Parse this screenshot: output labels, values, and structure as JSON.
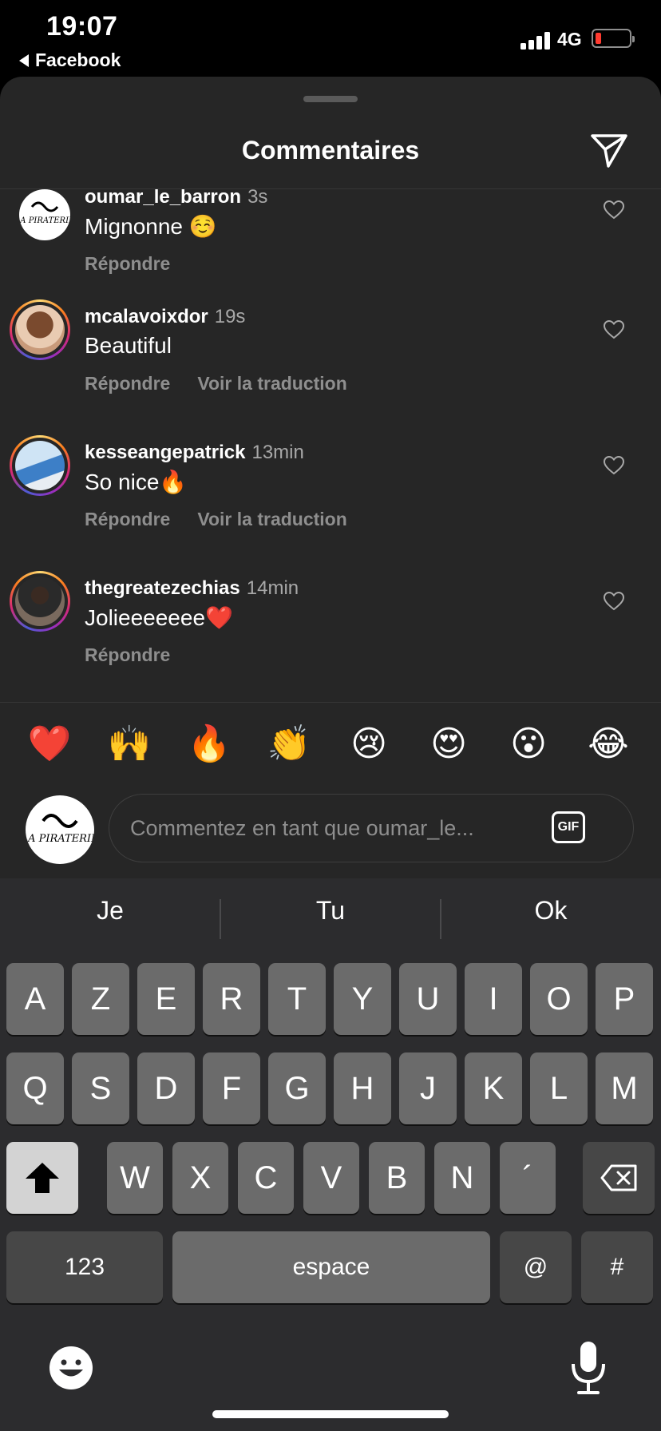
{
  "status_bar": {
    "time": "19:07",
    "back_app": "Facebook",
    "network": "4G"
  },
  "sheet": {
    "title": "Commentaires"
  },
  "comments": [
    {
      "username": "oumar_le_barron",
      "time": "3s",
      "text": "Mignonne ☺️",
      "actions": [
        "Répondre"
      ]
    },
    {
      "username": "mcalavoixdor",
      "time": "19s",
      "text": "Beautiful",
      "actions": [
        "Répondre",
        "Voir la traduction"
      ]
    },
    {
      "username": "kesseangepatrick",
      "time": "13min",
      "text": "So nice🔥",
      "actions": [
        "Répondre",
        "Voir la traduction"
      ]
    },
    {
      "username": "thegreatezechias",
      "time": "14min",
      "text": "Jolieeeeeee❤️",
      "actions": [
        "Répondre"
      ]
    }
  ],
  "quick_emojis": [
    "❤️",
    "🙌",
    "🔥",
    "👏",
    "😢",
    "😍",
    "😮",
    "😂"
  ],
  "composer": {
    "placeholder": "Commentez en tant que oumar_le...",
    "gif_label": "GIF",
    "avatar_text": "LA PIRATERIE"
  },
  "keyboard": {
    "suggestions": [
      "Je",
      "Tu",
      "Ok"
    ],
    "row1": [
      "A",
      "Z",
      "E",
      "R",
      "T",
      "Y",
      "U",
      "I",
      "O",
      "P"
    ],
    "row2": [
      "Q",
      "S",
      "D",
      "F",
      "G",
      "H",
      "J",
      "K",
      "L",
      "M"
    ],
    "row3": [
      "W",
      "X",
      "C",
      "V",
      "B",
      "N",
      "´"
    ],
    "numbers_key": "123",
    "space_key": "espace",
    "at_key": "@",
    "hash_key": "#"
  }
}
